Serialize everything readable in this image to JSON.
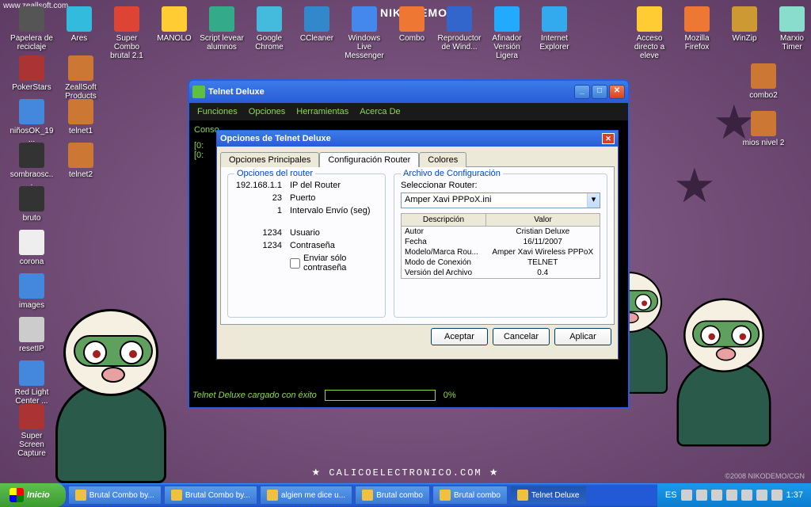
{
  "watermark": "www.zeallsoft.com",
  "logo_text": "NIKODEMO",
  "footer_text": "★ CALICOELECTRONICO.COM ★",
  "copyright": "©2008 NIKODEMO/CGN",
  "desktop_icons": {
    "r1": [
      "Papelera de reciclaje",
      "Ares",
      "Super Combo brutal 2.1",
      "MANOLO",
      "Script levear alumnos",
      "Google Chrome",
      "CCleaner",
      "Windows Live Messenger",
      "Combo",
      "Reproductor de Wind...",
      "Afinador Versión Ligera",
      "Internet Explorer",
      "",
      "Acceso directo a eleve",
      "Mozilla Firefox",
      "WinZip",
      "Marxio Timer"
    ],
    "c1": [
      "PokerStars",
      "niñosOK_19...",
      "sombraosc...",
      "bruto",
      "corona",
      "images",
      "resetIP",
      "Red Light Center ...",
      "Super Screen Capture"
    ],
    "c2": [
      "ZeallSoft Products",
      "telnet1",
      "telnet2"
    ],
    "right": [
      "combo2",
      "mios nivel 2"
    ]
  },
  "telnet_window": {
    "title": "Telnet Deluxe",
    "menu": [
      "Funciones",
      "Opciones",
      "Herramientas",
      "Acerca De"
    ],
    "console_lines": [
      "Conso",
      "[0:",
      "[0:"
    ],
    "status_msg": "Telnet Deluxe cargado con éxito",
    "status_pct": "0%"
  },
  "dialog": {
    "title": "Opciones de Telnet Deluxe",
    "tabs": [
      "Opciones Principales",
      "Configuración Router",
      "Colores"
    ],
    "router_opts": {
      "legend": "Opciones del router",
      "ip": "192.168.1.1",
      "ip_l": "IP del Router",
      "port": "23",
      "port_l": "Puerto",
      "intv": "1",
      "intv_l": "Intervalo Envío (seg)",
      "user": "1234",
      "user_l": "Usuario",
      "pass": "1234",
      "pass_l": "Contraseña",
      "chk": "Enviar sólo contraseña"
    },
    "config_file": {
      "legend": "Archivo de Configuración",
      "select_l": "Seleccionar Router:",
      "selected": "Amper Xavi PPPoX.ini",
      "th1": "Descripción",
      "th2": "Valor",
      "rows": [
        [
          "Autor",
          "Cristian Deluxe"
        ],
        [
          "Fecha",
          "16/11/2007"
        ],
        [
          "Modelo/Marca Rou...",
          "Amper Xavi Wireless PPPoX"
        ],
        [
          "Modo de Conexión",
          "TELNET"
        ],
        [
          "Versión del Archivo",
          "0.4"
        ]
      ]
    },
    "btns": [
      "Aceptar",
      "Cancelar",
      "Aplicar"
    ]
  },
  "taskbar": {
    "start": "Inicio",
    "buttons": [
      "Brutal Combo by...",
      "Brutal Combo by...",
      "algien me dice u...",
      "Brutal combo",
      "Brutal combo",
      "Telnet Deluxe"
    ],
    "lang": "ES",
    "clock": "1:37"
  }
}
